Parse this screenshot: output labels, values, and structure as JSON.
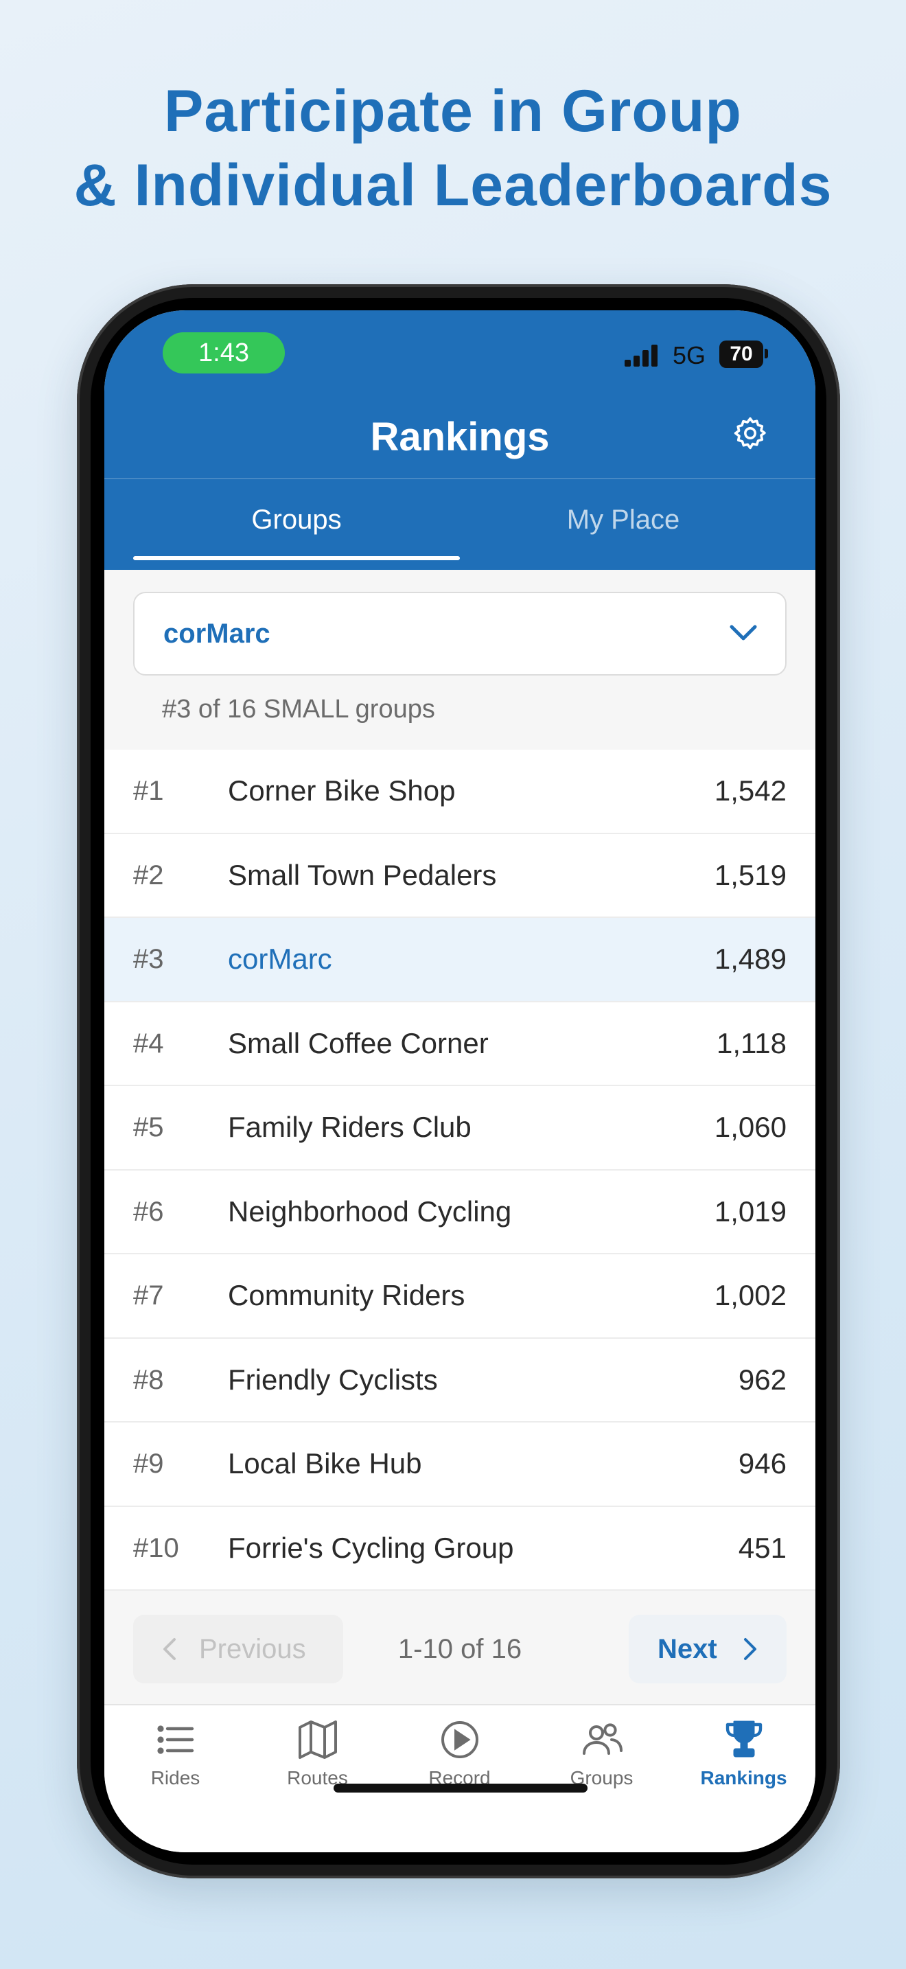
{
  "headline": {
    "line1": "Participate in Group",
    "line2": "& Individual Leaderboards"
  },
  "status_bar": {
    "time": "1:43",
    "network": "5G",
    "battery": "70"
  },
  "header": {
    "title": "Rankings",
    "settings_icon": "gear-icon",
    "tabs": [
      {
        "label": "Groups",
        "active": true
      },
      {
        "label": "My Place",
        "active": false
      }
    ]
  },
  "group_selector": {
    "value": "corMarc",
    "icon": "chevron-down-icon",
    "rank_text": "#3 of 16 SMALL groups"
  },
  "rankings": [
    {
      "rank": "#1",
      "name": "Corner Bike Shop",
      "score": "1,542"
    },
    {
      "rank": "#2",
      "name": "Small Town Pedalers",
      "score": "1,519"
    },
    {
      "rank": "#3",
      "name": "corMarc",
      "score": "1,489",
      "highlight": true
    },
    {
      "rank": "#4",
      "name": "Small Coffee Corner",
      "score": "1,118"
    },
    {
      "rank": "#5",
      "name": "Family Riders Club",
      "score": "1,060"
    },
    {
      "rank": "#6",
      "name": "Neighborhood Cycling",
      "score": "1,019"
    },
    {
      "rank": "#7",
      "name": "Community Riders",
      "score": "1,002"
    },
    {
      "rank": "#8",
      "name": "Friendly Cyclists",
      "score": "962"
    },
    {
      "rank": "#9",
      "name": "Local Bike Hub",
      "score": "946"
    },
    {
      "rank": "#10",
      "name": "Forrie's Cycling Group",
      "score": "451"
    }
  ],
  "pagination": {
    "previous_label": "Previous",
    "info": "1-10 of 16",
    "next_label": "Next"
  },
  "bottom_nav": [
    {
      "label": "Rides",
      "icon": "list-icon"
    },
    {
      "label": "Routes",
      "icon": "map-icon"
    },
    {
      "label": "Record",
      "icon": "play-circle-icon"
    },
    {
      "label": "Groups",
      "icon": "people-icon"
    },
    {
      "label": "Rankings",
      "icon": "trophy-icon",
      "active": true
    }
  ],
  "colors": {
    "brand_blue": "#1f6fb8",
    "status_green": "#34c759",
    "highlight_row": "#eaf3fb"
  }
}
